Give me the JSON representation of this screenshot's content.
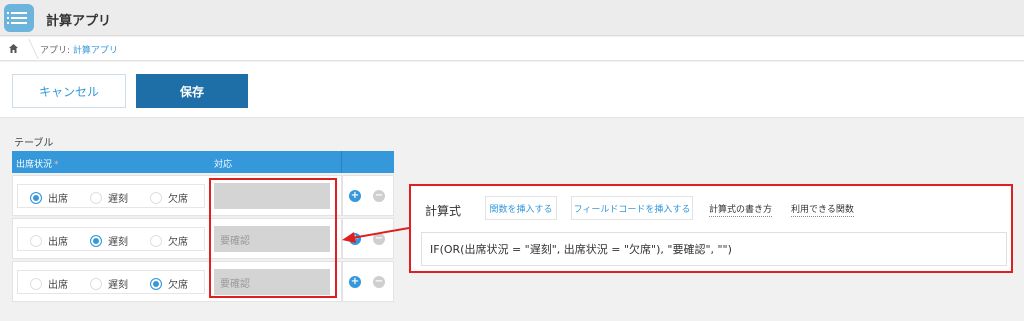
{
  "app": {
    "title": "計算アプリ"
  },
  "breadcrumb": {
    "prefix": "アプリ: ",
    "app_name": "計算アプリ"
  },
  "toolbar": {
    "cancel_label": "キャンセル",
    "save_label": "保存"
  },
  "table": {
    "label": "テーブル",
    "headers": {
      "status": "出席状況",
      "required_mark": "*",
      "action": "対応"
    },
    "radio_options": [
      "出席",
      "遅刻",
      "欠席"
    ],
    "rows": [
      {
        "selected": "出席",
        "value": "",
        "placeholder": ""
      },
      {
        "selected": "遅刻",
        "value": "要確認",
        "placeholder": ""
      },
      {
        "selected": "欠席",
        "value": "要確認",
        "placeholder": ""
      }
    ],
    "add_symbol": "+",
    "remove_symbol": "−"
  },
  "formula": {
    "label": "計算式",
    "insert_function": "関数を挿入する",
    "insert_field_code": "フィールドコードを挿入する",
    "how_to_write": "計算式の書き方",
    "available_functions": "利用できる関数",
    "expression": "IF(OR(出席状況 = \"遅刻\", 出席状況 = \"欠席\"), \"要確認\", \"\")"
  },
  "colors": {
    "accent": "#3498db",
    "save_button": "#1e6ea8",
    "highlight": "#e02020"
  }
}
